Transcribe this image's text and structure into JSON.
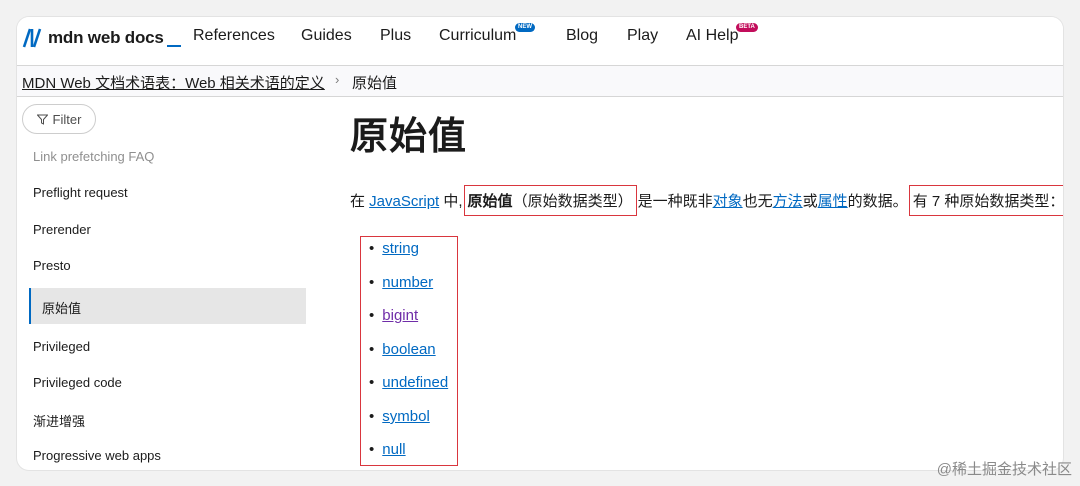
{
  "header": {
    "logo_text": "mdn web docs",
    "nav": [
      "References",
      "Guides",
      "Plus",
      "Curriculum",
      "Blog",
      "Play",
      "AI Help"
    ],
    "badges": {
      "curriculum": "NEW",
      "ai_help": "BETA"
    }
  },
  "breadcrumb": {
    "parent": "MDN Web 文档术语表：Web 相关术语的定义",
    "separator": "›",
    "current": "原始值"
  },
  "sidebar": {
    "filter_label": "Filter",
    "items": [
      "Link prefetching FAQ",
      "Preflight request",
      "Prerender",
      "Presto",
      "原始值",
      "Privileged",
      "Privileged code",
      "渐进增强",
      "Progressive web apps"
    ],
    "active_index": 4
  },
  "main": {
    "title": "原始值",
    "para": {
      "t1": "在 ",
      "link_js": "JavaScript",
      "t2": " 中,",
      "bold": "原始值",
      "t3": "（原始数据类型）",
      "t4": "是一种既非",
      "link_obj": "对象",
      "t5": "也无",
      "link_method": "方法",
      "t6": "或",
      "link_prop": "属性",
      "t7": "的数据。",
      "t8": "有 7 种原始数据类型："
    },
    "types": [
      "string",
      "number",
      "bigint",
      "boolean",
      "undefined",
      "symbol",
      "null"
    ]
  },
  "watermark": "@稀土掘金技术社区",
  "colors": {
    "accent": "#0069c2",
    "highlight_border": "#d9363e",
    "visited": "#6f2da8"
  }
}
